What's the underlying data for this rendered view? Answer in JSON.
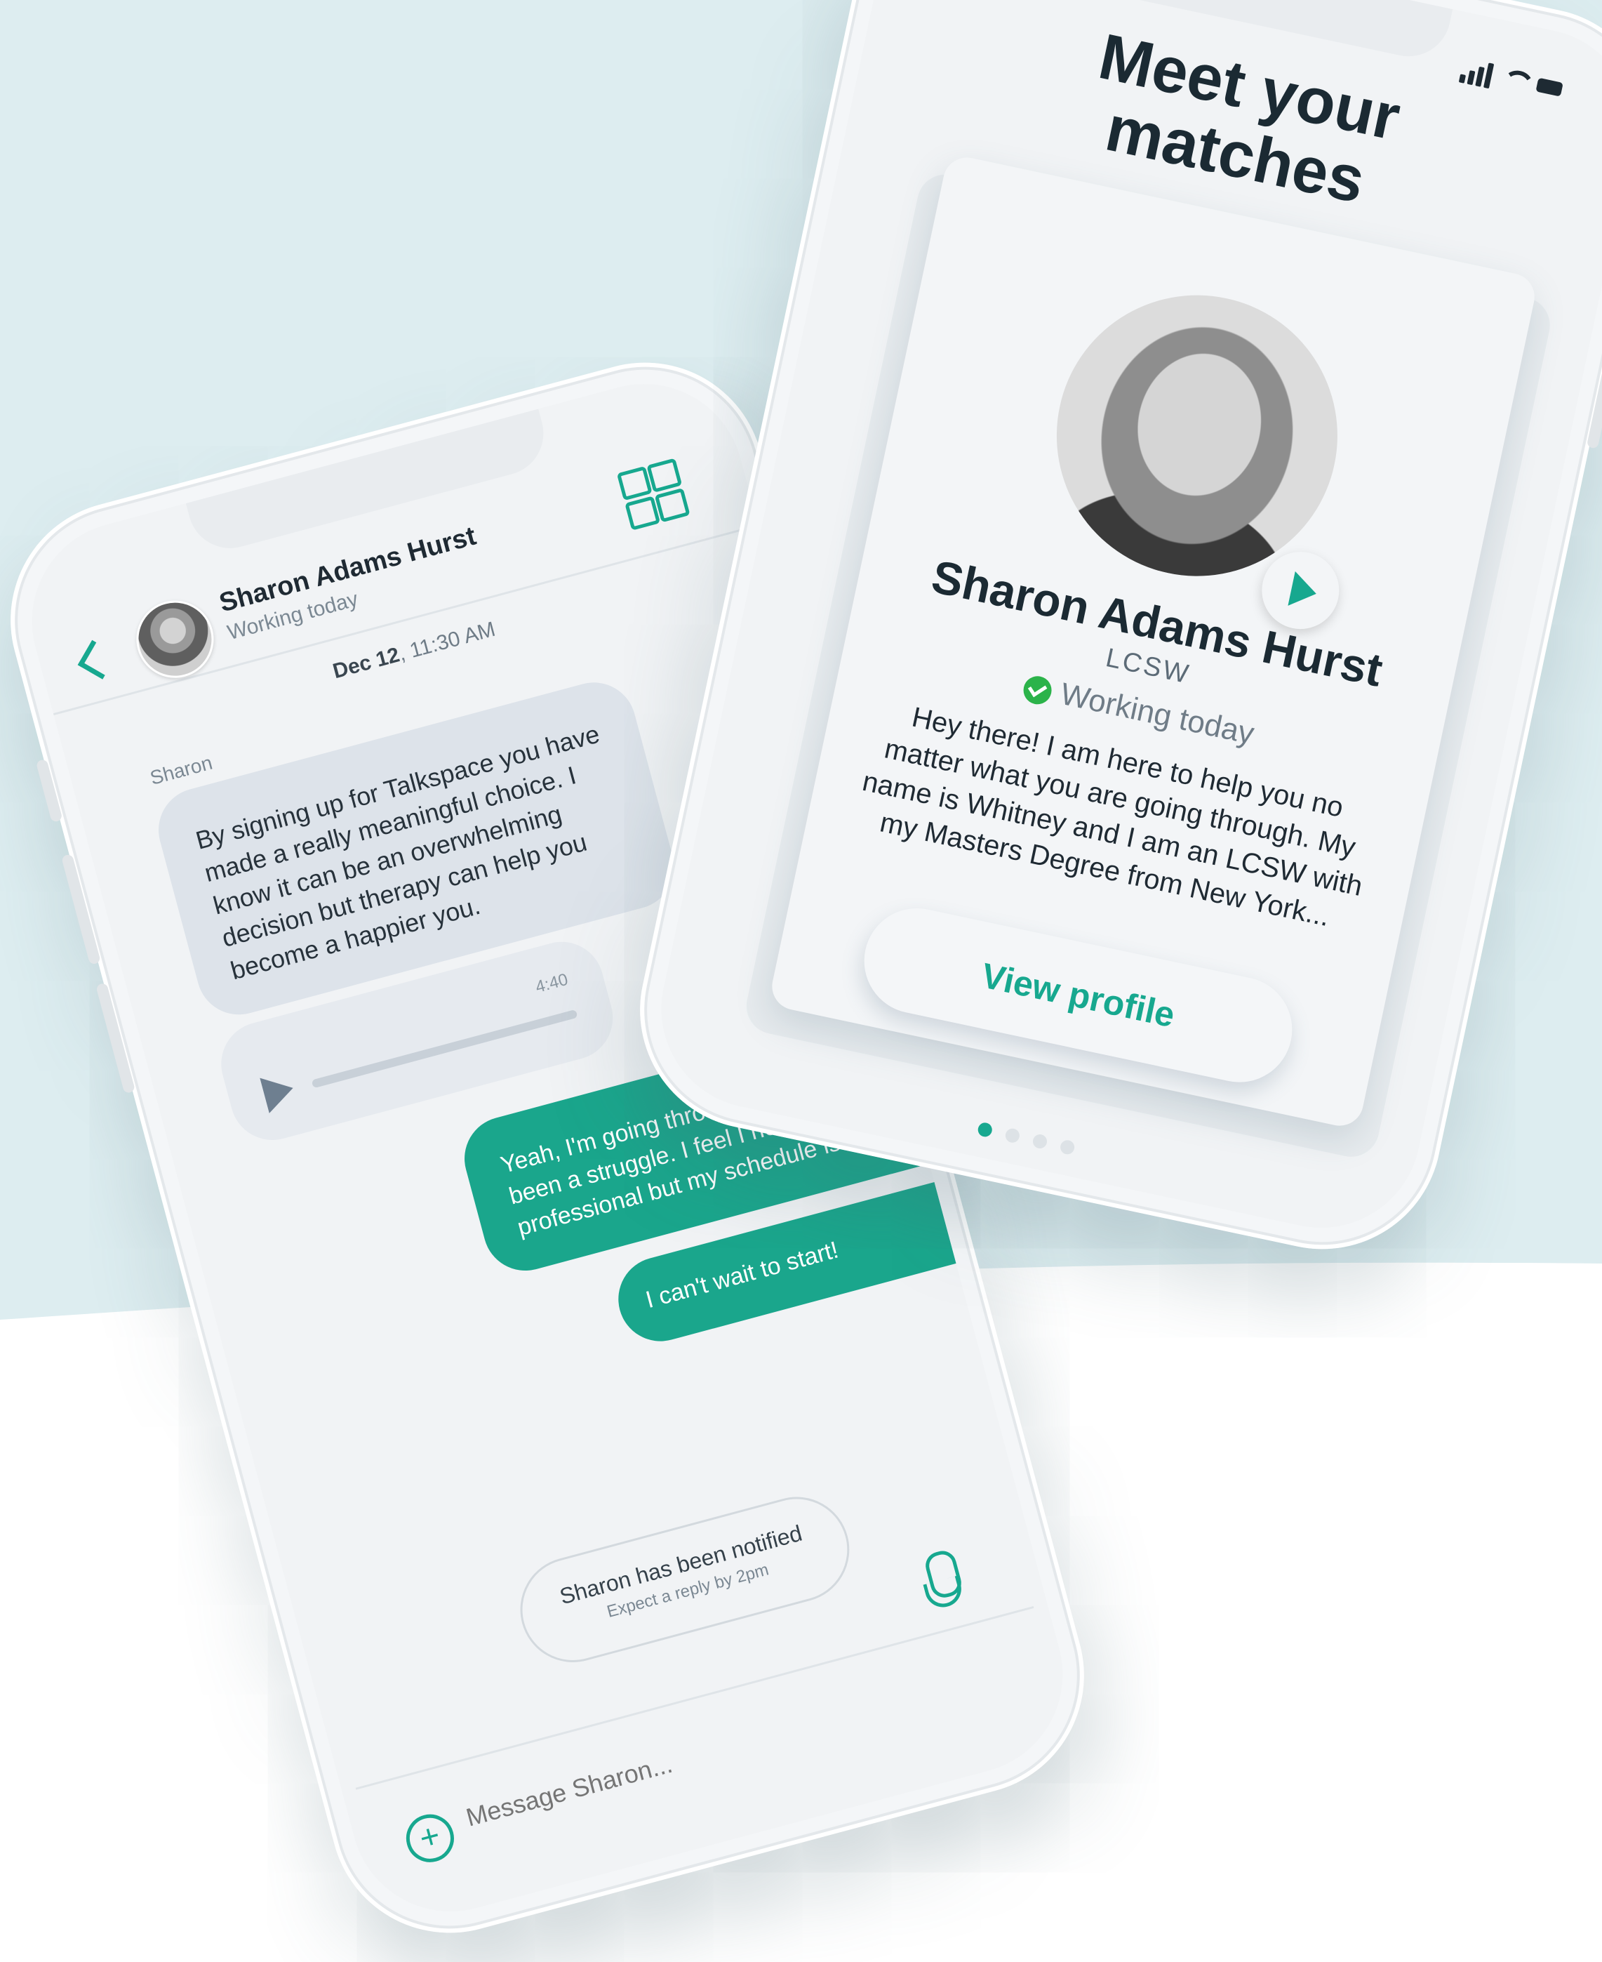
{
  "colors": {
    "accent": "#17a88f",
    "bubble_outgoing": "#1aa68c",
    "bubble_incoming": "#dde3ea",
    "background_top": "#ddedf0",
    "text_dark": "#1b2a33"
  },
  "chat": {
    "contact_name": "Sharon Adams Hurst",
    "contact_status": "Working today",
    "date_bold": "Dec 12",
    "date_rest": ", 11:30 AM",
    "sender_label": "Sharon",
    "incoming_message": "By signing up for Talkspace you have made a really meaningful choice. I know it can be an overwhelming decision but therapy can help you become a happier you.",
    "audio_duration": "4:40",
    "outgoing_message_1": "Yeah, I'm going through a lot and it's been a struggle. I feel I need to talk to a professional but my schedule is so busy.",
    "outgoing_message_2": "I can't wait to start!",
    "notification_title": "Sharon has been notified",
    "notification_subtitle": "Expect a reply by 2pm",
    "composer_placeholder": "Message Sharon..."
  },
  "profile": {
    "title_line1": "Meet your",
    "title_line2": "matches",
    "name": "Sharon Adams Hurst",
    "credential": "LCSW",
    "status": "Working today",
    "bio": "Hey there! I am here to help you no matter what you are going through. My name is Whitney and I am an LCSW with my Masters Degree from New York...",
    "view_profile_label": "View profile",
    "pagination": {
      "total": 4,
      "active": 1
    }
  },
  "icons": [
    "back-chevron-icon",
    "dashboard-grid-icon",
    "play-icon",
    "microphone-icon",
    "plus-circle-icon",
    "signal-icon",
    "wifi-icon",
    "battery-icon",
    "check-circle-icon"
  ]
}
